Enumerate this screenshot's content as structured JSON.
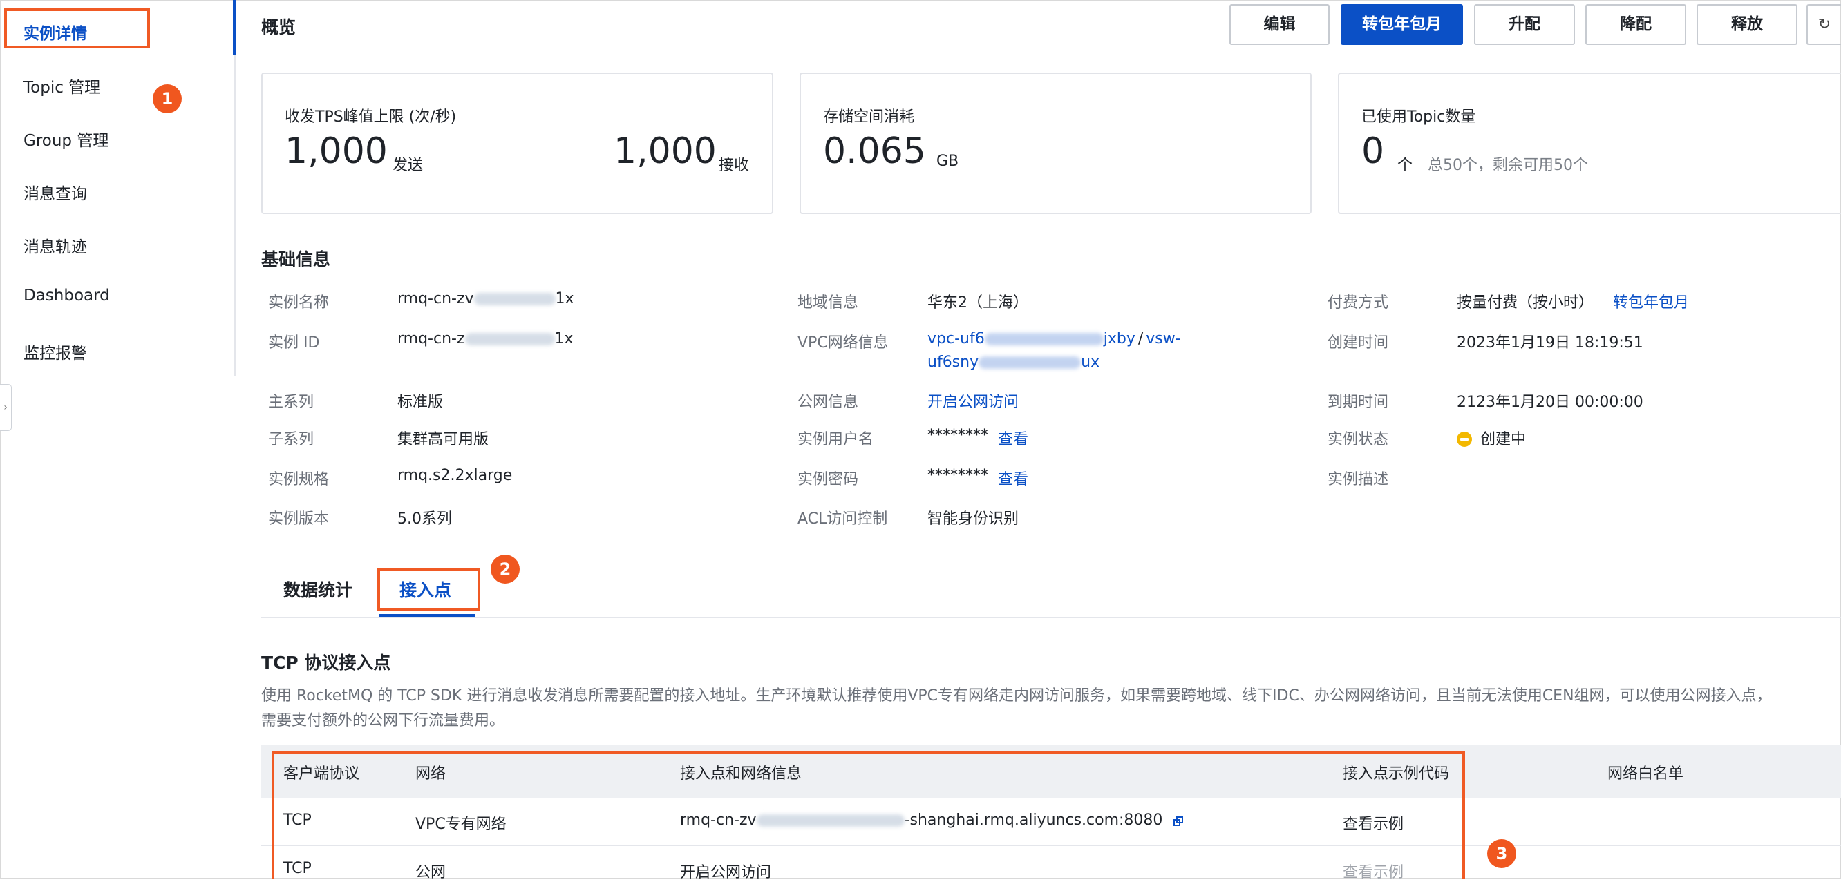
{
  "sidebar": {
    "items": [
      {
        "label": "实例详情"
      },
      {
        "label": "Topic 管理"
      },
      {
        "label": "Group 管理"
      },
      {
        "label": "消息查询"
      },
      {
        "label": "消息轨迹"
      },
      {
        "label": "Dashboard"
      },
      {
        "label": "监控报警"
      }
    ],
    "toggle_icon": "›"
  },
  "badges": {
    "one": "1",
    "two": "2",
    "three": "3"
  },
  "header": {
    "title": "概览",
    "buttons": {
      "edit": "编辑",
      "to_monthly": "转包年包月",
      "upgrade": "升配",
      "downgrade": "降配",
      "release": "释放"
    },
    "refresh_icon": "↻"
  },
  "stats": {
    "tps": {
      "label": "收发TPS峰值上限 (次/秒)",
      "send_value": "1,000",
      "send_unit": "发送",
      "recv_value": "1,000",
      "recv_unit": "接收"
    },
    "storage": {
      "label": "存储空间消耗",
      "value": "0.065",
      "unit": "GB"
    },
    "topics": {
      "label": "已使用Topic数量",
      "value": "0",
      "unit": "个",
      "note": "总50个，剩余可用50个"
    }
  },
  "basic_info": {
    "title": "基础信息",
    "instance_name": {
      "label": "实例名称",
      "prefix": "rmq-cn-zv",
      "suffix": "1x"
    },
    "instance_id": {
      "label": "实例 ID",
      "prefix": "rmq-cn-z",
      "suffix": "1x"
    },
    "series": {
      "label": "主系列",
      "value": "标准版"
    },
    "sub_series": {
      "label": "子系列",
      "value": "集群高可用版"
    },
    "spec": {
      "label": "实例规格",
      "value": "rmq.s2.2xlarge"
    },
    "version": {
      "label": "实例版本",
      "value": "5.0系列"
    },
    "region": {
      "label": "地域信息",
      "value": "华东2（上海）"
    },
    "vpc": {
      "label": "VPC网络信息",
      "vpc_prefix": "vpc-uf6",
      "vpc_suffix": "jxby",
      "separator": "/",
      "vsw_prefix": "vsw-",
      "line2_prefix": "uf6sny",
      "line2_suffix": "ux"
    },
    "public": {
      "label": "公网信息",
      "value": "开启公网访问"
    },
    "username": {
      "label": "实例用户名",
      "value": "********",
      "link": "查看"
    },
    "password": {
      "label": "实例密码",
      "value": "********",
      "link": "查看"
    },
    "acl": {
      "label": "ACL访问控制",
      "value": "智能身份识别"
    },
    "billing": {
      "label": "付费方式",
      "value": "按量付费（按小时）",
      "link": "转包年包月"
    },
    "created": {
      "label": "创建时间",
      "value": "2023年1月19日 18:19:51"
    },
    "expire": {
      "label": "到期时间",
      "value": "2123年1月20日 00:00:00"
    },
    "status": {
      "label": "实例状态",
      "value": "创建中"
    },
    "description": {
      "label": "实例描述"
    }
  },
  "tabs": [
    {
      "label": "数据统计"
    },
    {
      "label": "接入点"
    }
  ],
  "tcp": {
    "title": "TCP 协议接入点",
    "desc_line1": "使用 RocketMQ 的 TCP SDK 进行消息收发消息所需要配置的接入地址。生产环境默认推荐使用VPC专有网络走内网访问服务，如果需要跨地域、线下IDC、办公网网络访问，且当前无法使用CEN组网，可以使用公网接入点，",
    "desc_line2": "需要支付额外的公网下行流量费用。",
    "columns": [
      "客户端协议",
      "网络",
      "接入点和网络信息",
      "接入点示例代码",
      "网络白名单"
    ],
    "rows": [
      {
        "protocol": "TCP",
        "network": "VPC专有网络",
        "endpoint_prefix": "rmq-cn-zv",
        "endpoint_suffix": "-shanghai.rmq.aliyuncs.com:8080",
        "example": "查看示例"
      },
      {
        "protocol": "TCP",
        "network": "公网",
        "endpoint_link": "开启公网访问",
        "example": "查看示例"
      }
    ]
  }
}
